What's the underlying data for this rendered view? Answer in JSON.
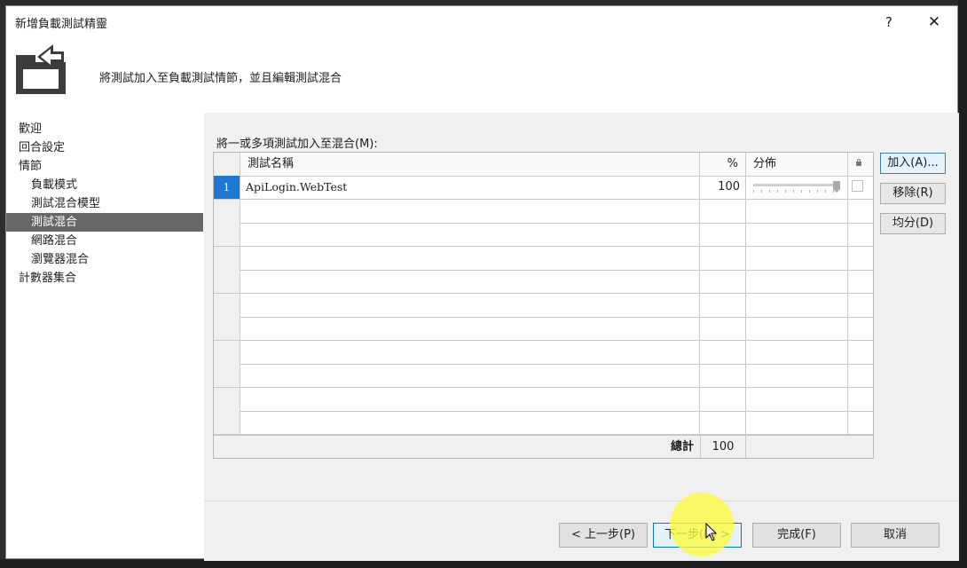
{
  "dialog": {
    "title": "新增負載測試精靈",
    "help_label": "?",
    "close_label": "✕",
    "header_text": "將測試加入至負載測試情節，並且編輯測試混合"
  },
  "nav": {
    "items": [
      {
        "label": "歡迎"
      },
      {
        "label": "回合設定"
      },
      {
        "label": "情節"
      },
      {
        "label": "負載模式"
      },
      {
        "label": "測試混合模型"
      },
      {
        "label": "測試混合"
      },
      {
        "label": "網路混合"
      },
      {
        "label": "瀏覽器混合"
      },
      {
        "label": "計數器集合"
      }
    ],
    "selected": "測試混合"
  },
  "mix": {
    "label": "將一或多項測試加入至混合(M):",
    "columns": {
      "name": "測試名稱",
      "percent": "%",
      "distribution": "分佈"
    },
    "rows": [
      {
        "index": "1",
        "name": "ApiLogin.WebTest",
        "percent": "100",
        "distribution_fraction": 1.0,
        "locked": false
      }
    ],
    "total_label": "總計",
    "total_value": "100"
  },
  "side_buttons": {
    "add": "加入(A)...",
    "remove": "移除(R)",
    "distribute": "均分(D)"
  },
  "wizard_buttons": {
    "previous": "< 上一步(P)",
    "next": "下一步(N) >",
    "finish": "完成(F)",
    "cancel": "取消"
  },
  "colors": {
    "selected_nav": "#666666",
    "selected_row_header": "#1e78d2",
    "cursor_highlight": "#fff83c"
  }
}
